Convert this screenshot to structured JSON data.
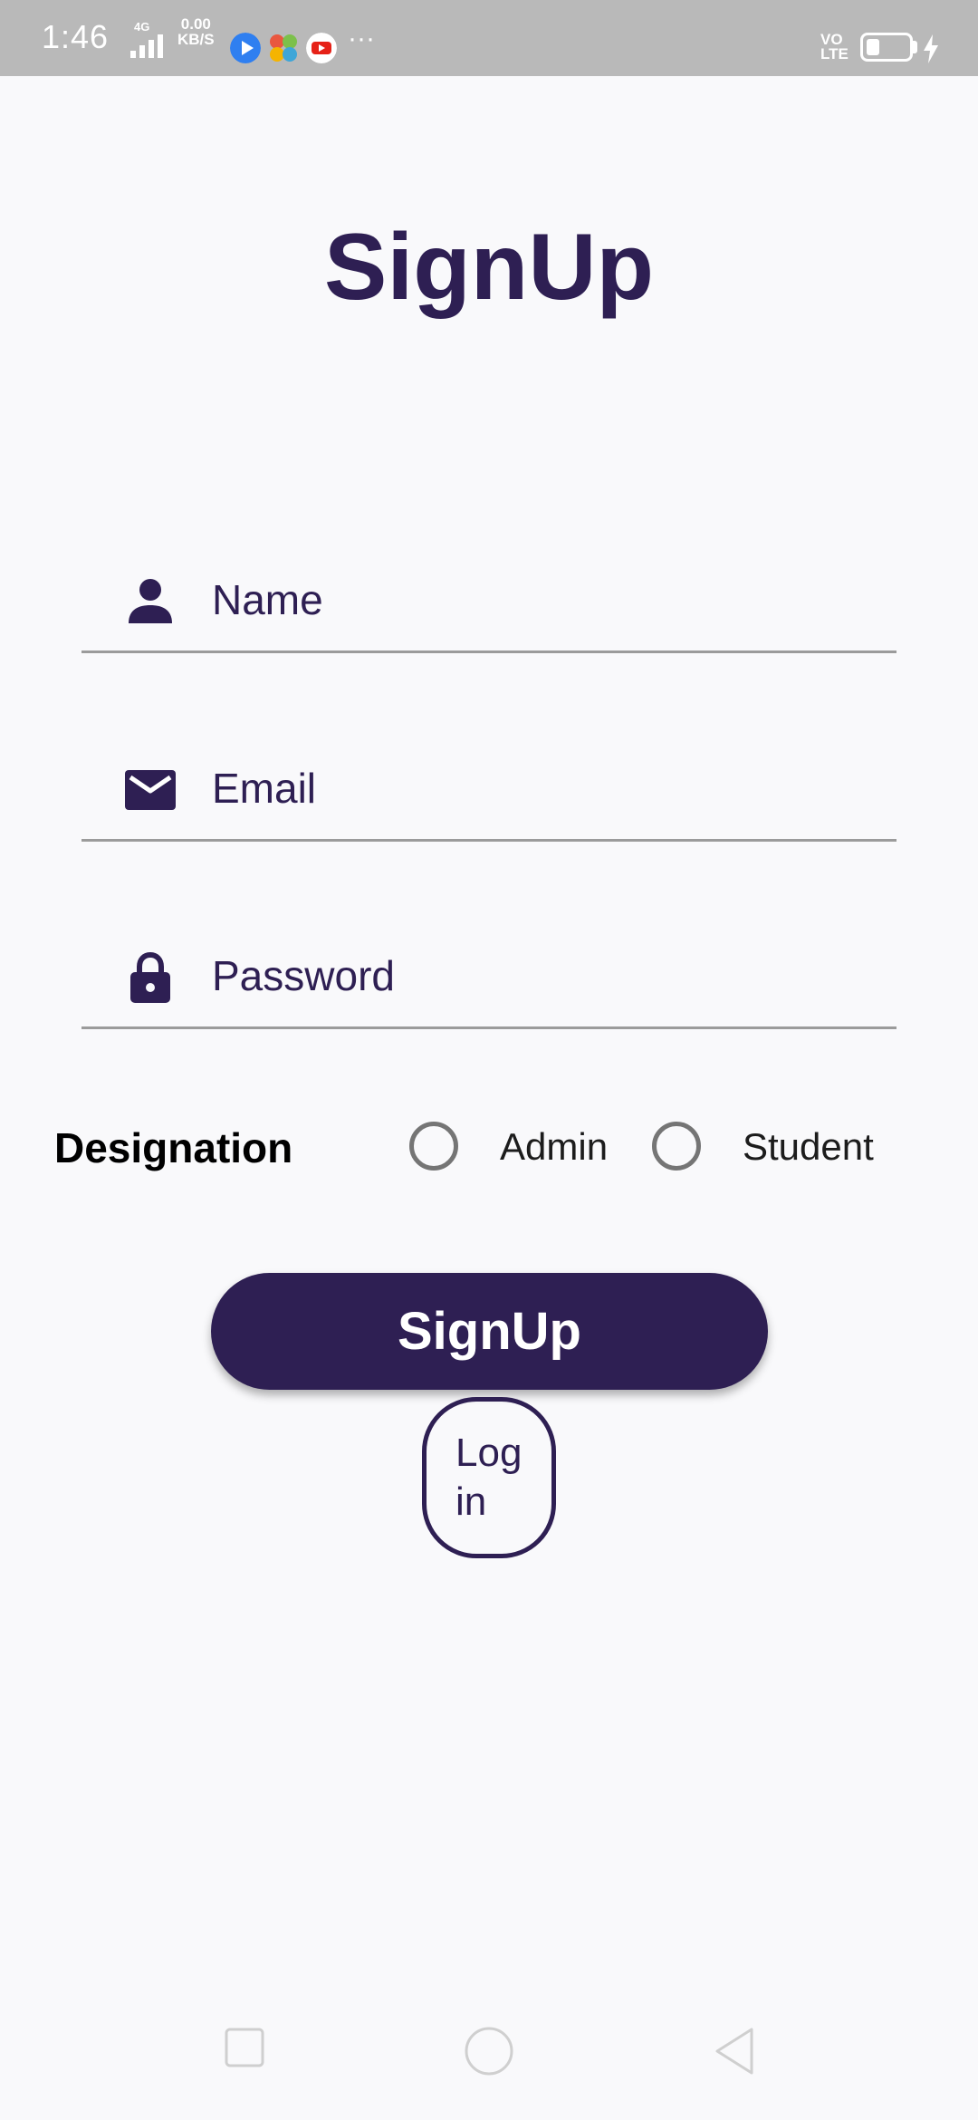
{
  "status_bar": {
    "time": "1:46",
    "network_label": "4G",
    "speed_value": "0.00",
    "speed_unit": "KB/S",
    "more": "···",
    "volte_top": "VO",
    "volte_bottom": "LTE",
    "icons": [
      "play-app-icon",
      "photos-app-icon",
      "youtube-app-icon",
      "battery-icon",
      "charging-icon"
    ]
  },
  "title": "SignUp",
  "form": {
    "name_placeholder": "Name",
    "name_value": "",
    "email_placeholder": "Email",
    "email_value": "",
    "password_placeholder": "Password",
    "password_value": ""
  },
  "designation": {
    "label": "Designation",
    "options": [
      {
        "label": "Admin",
        "selected": false
      },
      {
        "label": "Student",
        "selected": false
      }
    ]
  },
  "buttons": {
    "signup_label": "SignUp",
    "login_line1": "Log",
    "login_line2": "in"
  },
  "colors": {
    "primary": "#2e1f53",
    "background": "#f9f9fb",
    "status_bar": "#b9b9b9",
    "divider": "#9b9b9b",
    "radio": "#757575"
  },
  "nav_bar": {
    "icons": [
      "recents-square-icon",
      "home-circle-icon",
      "back-triangle-icon"
    ]
  }
}
